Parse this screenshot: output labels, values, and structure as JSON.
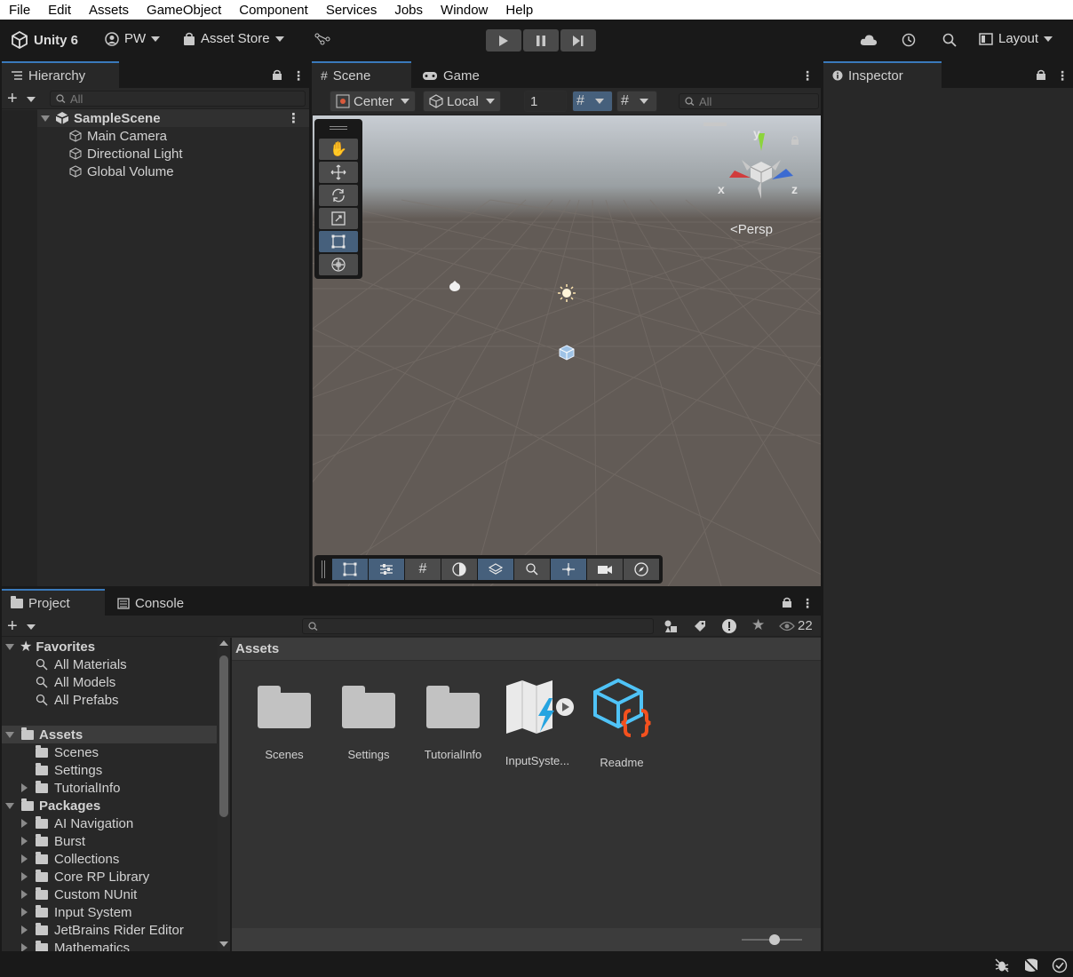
{
  "menu": [
    "File",
    "Edit",
    "Assets",
    "GameObject",
    "Component",
    "Services",
    "Jobs",
    "Window",
    "Help"
  ],
  "toolbar": {
    "app_label": "Unity 6",
    "account_label": "PW",
    "asset_store_label": "Asset Store",
    "layout_label": "Layout"
  },
  "hierarchy": {
    "tab_label": "Hierarchy",
    "search_placeholder": "All",
    "scene_name": "SampleScene",
    "objects": [
      "Main Camera",
      "Directional Light",
      "Global Volume"
    ]
  },
  "scene": {
    "tab_scene": "Scene",
    "tab_game": "Game",
    "pivot_label": "Center",
    "space_label": "Local",
    "grid_value": "1",
    "search_placeholder": "All",
    "gizmo_x": "x",
    "gizmo_y": "y",
    "gizmo_z": "z",
    "projection_label": "Persp"
  },
  "inspector": {
    "tab_label": "Inspector"
  },
  "project": {
    "tab_project": "Project",
    "tab_console": "Console",
    "hidden_count": "22",
    "breadcrumb": "Assets",
    "favorites_label": "Favorites",
    "favorites": [
      "All Materials",
      "All Models",
      "All Prefabs"
    ],
    "assets_label": "Assets",
    "asset_folders": [
      "Scenes",
      "Settings",
      "TutorialInfo"
    ],
    "packages_label": "Packages",
    "packages": [
      "AI Navigation",
      "Burst",
      "Collections",
      "Core RP Library",
      "Custom NUnit",
      "Input System",
      "JetBrains Rider Editor",
      "Mathematics"
    ],
    "grid_items": [
      "Scenes",
      "Settings",
      "TutorialInfo",
      "InputSyste...",
      "Readme"
    ],
    "thumbnail_zoom": 0.55
  },
  "colors": {
    "accent": "#3a79bb",
    "panel": "#282828",
    "background": "#191919",
    "active_tool": "#46607c",
    "gizmo_x": "#d13c3c",
    "gizmo_y": "#8cd43c",
    "gizmo_z": "#3c6bd1"
  }
}
